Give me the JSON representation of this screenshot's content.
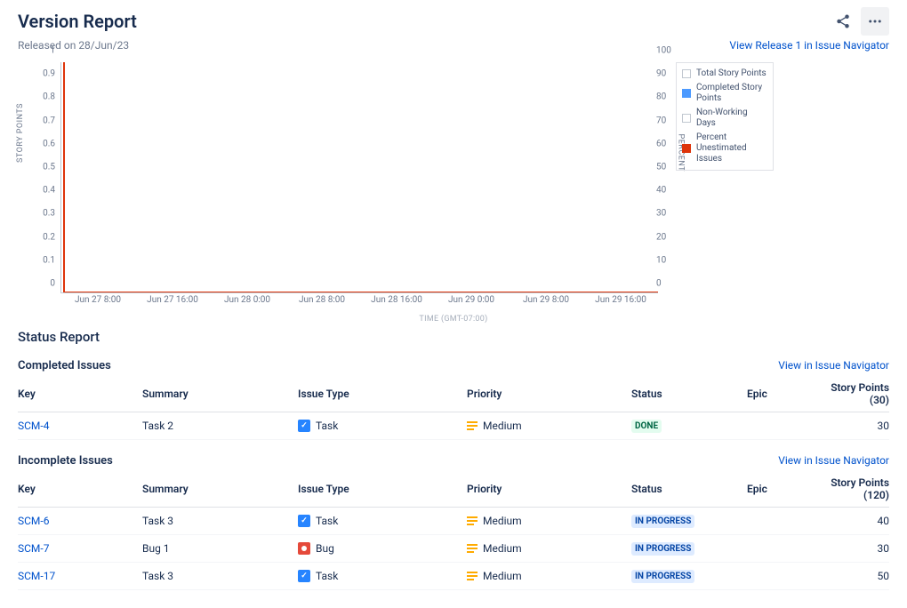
{
  "header": {
    "title": "Version Report",
    "released_text": "Released on 28/Jun/23",
    "view_link": "View Release 1 in Issue Navigator"
  },
  "chart_data": {
    "type": "line",
    "title": "",
    "xlabel": "TIME (GMT-07:00)",
    "ylabel": "STORY POINTS",
    "y2label": "PERCENT",
    "ylim": [
      0,
      1
    ],
    "y2lim": [
      0,
      100
    ],
    "y_ticks": [
      "0",
      "0.1",
      "0.2",
      "0.3",
      "0.4",
      "0.5",
      "0.6",
      "0.7",
      "0.8",
      "0.9",
      "1"
    ],
    "y2_ticks": [
      "0",
      "10",
      "20",
      "30",
      "40",
      "50",
      "60",
      "70",
      "80",
      "90",
      "100"
    ],
    "x_ticks": [
      "Jun 27 8:00",
      "Jun 27 16:00",
      "Jun 28 0:00",
      "Jun 28 8:00",
      "Jun 28 16:00",
      "Jun 29 0:00",
      "Jun 29 8:00",
      "Jun 29 16:00"
    ],
    "legend": [
      {
        "name": "Total Story Points",
        "color": "#ffffff"
      },
      {
        "name": "Completed Story Points",
        "color": "#4c9aff"
      },
      {
        "name": "Non-Working Days",
        "color": "#ffffff"
      },
      {
        "name": "Percent Unestimated Issues",
        "color": "#de350b"
      }
    ],
    "series": [
      {
        "name": "Percent Unestimated Issues",
        "x": [
          "Jun 27 8:00",
          "Jun 27 8:00",
          "Jun 29 16:00"
        ],
        "y": [
          100,
          0,
          0
        ]
      }
    ]
  },
  "status_report": {
    "title": "Status Report",
    "view_link": "View in Issue Navigator",
    "columns": {
      "key": "Key",
      "summary": "Summary",
      "type": "Issue Type",
      "priority": "Priority",
      "status": "Status",
      "epic": "Epic"
    },
    "completed": {
      "title": "Completed Issues",
      "sp_header": "Story Points (30)",
      "rows": [
        {
          "key": "SCM-4",
          "summary": "Task 2",
          "type": "Task",
          "type_icon": "task",
          "priority": "Medium",
          "status": "DONE",
          "status_class": "lz-done",
          "epic": "",
          "sp": "30"
        }
      ]
    },
    "incomplete": {
      "title": "Incomplete Issues",
      "sp_header": "Story Points (120)",
      "rows": [
        {
          "key": "SCM-6",
          "summary": "Task 3",
          "type": "Task",
          "type_icon": "task",
          "priority": "Medium",
          "status": "IN PROGRESS",
          "status_class": "lz-inprogress",
          "epic": "",
          "sp": "40"
        },
        {
          "key": "SCM-7",
          "summary": "Bug 1",
          "type": "Bug",
          "type_icon": "bug",
          "priority": "Medium",
          "status": "IN PROGRESS",
          "status_class": "lz-inprogress",
          "epic": "",
          "sp": "30"
        },
        {
          "key": "SCM-17",
          "summary": "Task 3",
          "type": "Task",
          "type_icon": "task",
          "priority": "Medium",
          "status": "IN PROGRESS",
          "status_class": "lz-inprogress",
          "epic": "",
          "sp": "50"
        }
      ]
    }
  }
}
